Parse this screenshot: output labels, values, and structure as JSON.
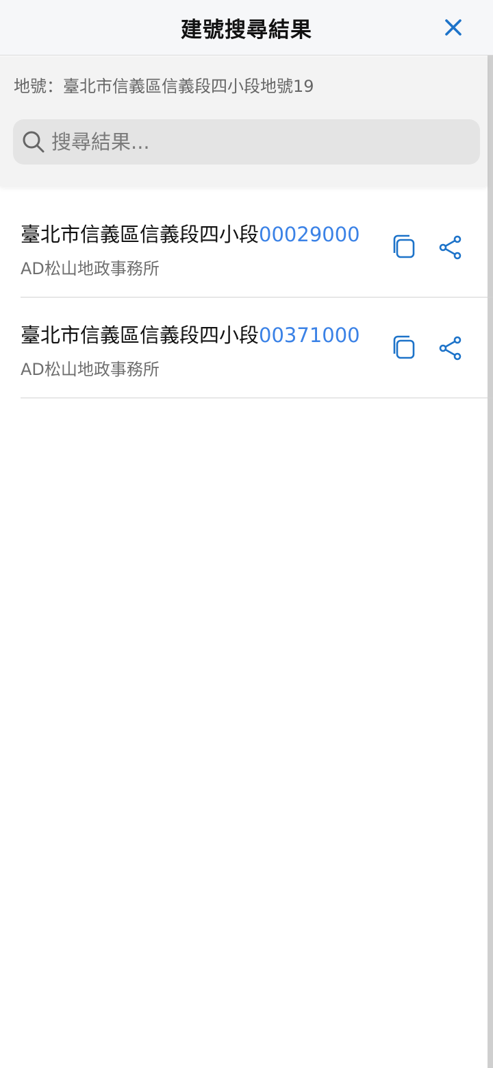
{
  "header": {
    "title": "建號搜尋結果",
    "close_icon": "close-icon",
    "accent_color": "#1d73c9"
  },
  "query": {
    "label": "地號：臺北市信義區信義段四小段地號19"
  },
  "search": {
    "placeholder": "搜尋結果...",
    "value": "",
    "icon": "search-icon"
  },
  "results": [
    {
      "title": "臺北市信義區信義段四小段",
      "number": "00029000",
      "office": "AD松山地政事務所",
      "copy_icon": "copy-icon",
      "share_icon": "share-icon"
    },
    {
      "title": "臺北市信義區信義段四小段",
      "number": "00371000",
      "office": "AD松山地政事務所",
      "copy_icon": "copy-icon",
      "share_icon": "share-icon"
    }
  ],
  "colors": {
    "link_number": "#3b82e6",
    "icon": "#1d73c9"
  }
}
